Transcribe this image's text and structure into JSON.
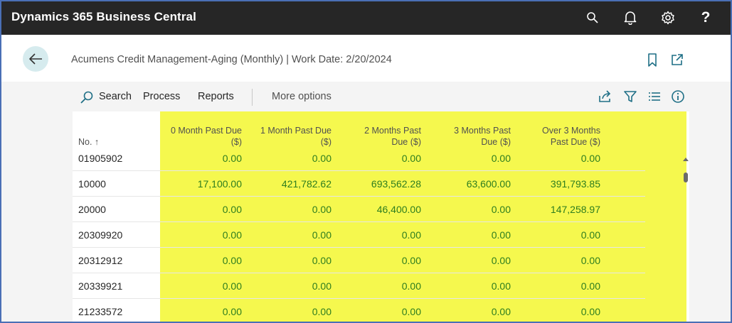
{
  "app": {
    "title": "Dynamics 365 Business Central"
  },
  "topbar": {
    "icons": [
      "search-icon",
      "bell-icon",
      "gear-icon",
      "help-icon"
    ],
    "help_label": "?"
  },
  "header": {
    "title": "Acumens Credit Management-Aging (Monthly) | Work Date: 2/20/2024"
  },
  "actionbar": {
    "search_label": "Search",
    "process_label": "Process",
    "reports_label": "Reports",
    "more_label": "More options"
  },
  "colors": {
    "highlight": "#f5f84e",
    "amount_green": "#2e7d1f",
    "topbar": "#262626",
    "back_button_bg": "#d6ebee"
  },
  "table": {
    "columns": [
      {
        "line1": "No. ↑",
        "line2": ""
      },
      {
        "line1": "0 Month Past Due",
        "line2": "($)"
      },
      {
        "line1": "1 Month Past Due",
        "line2": "($)"
      },
      {
        "line1": "2 Months Past",
        "line2": "Due ($)"
      },
      {
        "line1": "3 Months Past",
        "line2": "Due ($)"
      },
      {
        "line1": "Over 3 Months",
        "line2": "Past Due ($)"
      }
    ],
    "rows": [
      [
        "01905902",
        "0.00",
        "0.00",
        "0.00",
        "0.00",
        "0.00"
      ],
      [
        "10000",
        "17,100.00",
        "421,782.62",
        "693,562.28",
        "63,600.00",
        "391,793.85"
      ],
      [
        "20000",
        "0.00",
        "0.00",
        "46,400.00",
        "0.00",
        "147,258.97"
      ],
      [
        "20309920",
        "0.00",
        "0.00",
        "0.00",
        "0.00",
        "0.00"
      ],
      [
        "20312912",
        "0.00",
        "0.00",
        "0.00",
        "0.00",
        "0.00"
      ],
      [
        "20339921",
        "0.00",
        "0.00",
        "0.00",
        "0.00",
        "0.00"
      ],
      [
        "21233572",
        "0.00",
        "0.00",
        "0.00",
        "0.00",
        "0.00"
      ]
    ]
  }
}
